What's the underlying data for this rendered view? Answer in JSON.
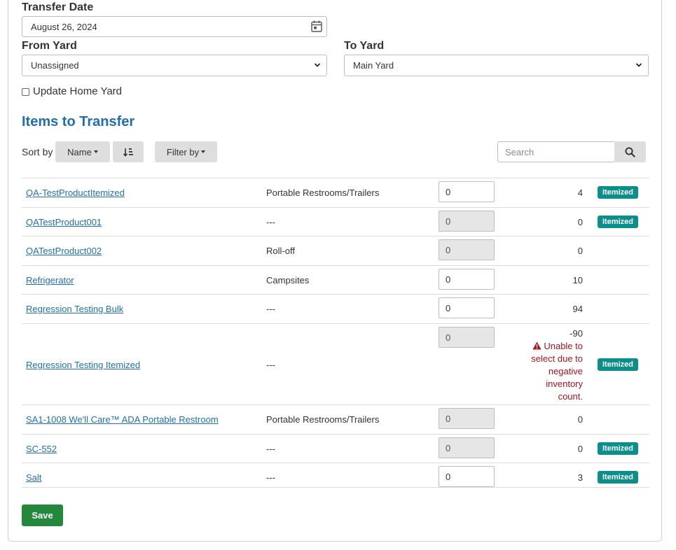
{
  "transfer_date": {
    "label": "Transfer Date",
    "value": "August 26, 2024"
  },
  "from_yard": {
    "label": "From Yard",
    "value": "Unassigned"
  },
  "to_yard": {
    "label": "To Yard",
    "value": "Main Yard"
  },
  "update_home_yard": {
    "label": "Update Home Yard",
    "checked": false
  },
  "items_title": "Items to Transfer",
  "toolbar": {
    "sort_label": "Sort by",
    "sort_value": "Name",
    "filter_label": "Filter by",
    "search_placeholder": "Search"
  },
  "rows": [
    {
      "name": "QA-TestProductItemized",
      "category": "Portable Restrooms/Trailers",
      "qty": "0",
      "qty_disabled": false,
      "count": "4",
      "badge": "Itemized"
    },
    {
      "name": "QATestProduct001",
      "category": "---",
      "qty": "0",
      "qty_disabled": true,
      "count": "0",
      "badge": "Itemized"
    },
    {
      "name": "QATestProduct002",
      "category": "Roll-off",
      "qty": "0",
      "qty_disabled": true,
      "count": "0",
      "badge": ""
    },
    {
      "name": "Refrigerator",
      "category": "Campsites",
      "qty": "0",
      "qty_disabled": false,
      "count": "10",
      "badge": ""
    },
    {
      "name": "Regression Testing Bulk",
      "category": "---",
      "qty": "0",
      "qty_disabled": false,
      "count": "94",
      "badge": ""
    },
    {
      "name": "Regression Testing Itemized",
      "category": "---",
      "qty": "0",
      "qty_disabled": true,
      "count": "-90",
      "warning": "Unable to select due to negative inventory count.",
      "badge": "Itemized"
    },
    {
      "name": "SA1-1008 We'll Care™ ADA Portable Restroom",
      "category": "Portable Restrooms/Trailers",
      "qty": "0",
      "qty_disabled": true,
      "count": "0",
      "badge": ""
    },
    {
      "name": "SC-552",
      "category": "---",
      "qty": "0",
      "qty_disabled": true,
      "count": "0",
      "badge": "Itemized"
    },
    {
      "name": "Salt",
      "category": "---",
      "qty": "0",
      "qty_disabled": false,
      "count": "3",
      "badge": "Itemized"
    }
  ],
  "save_label": "Save",
  "colors": {
    "link": "#1f6fb2",
    "badge": "#0a8f8a",
    "save": "#23873c",
    "warning": "#b0121b"
  },
  "icons": {
    "date": "calendar-icon",
    "select": "chevron-down-icon",
    "search": "search-icon",
    "sort_direction": "sort-direction-icon",
    "warning": "warning-icon"
  }
}
